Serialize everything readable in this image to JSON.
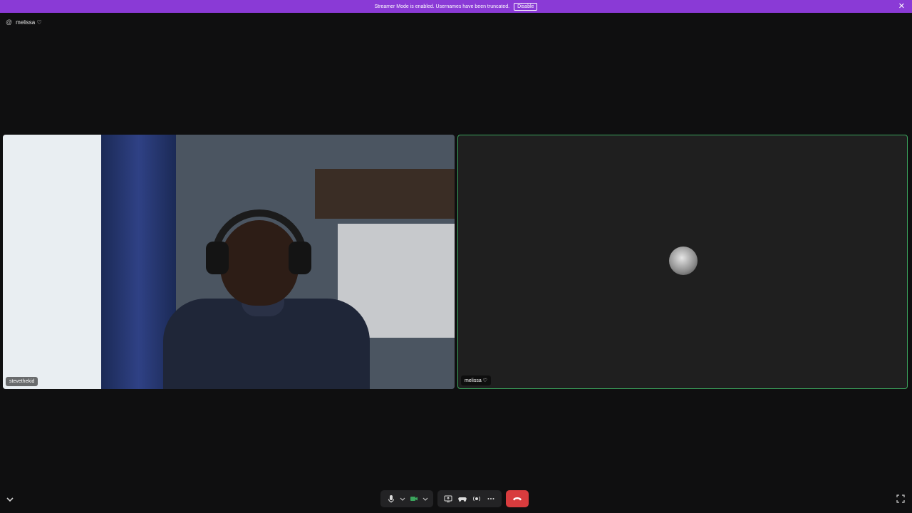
{
  "banner": {
    "message": "Streamer Mode is enabled. Usernames have been truncated.",
    "disable_label": "Disable"
  },
  "topbar": {
    "channel_name": "melissa ♡"
  },
  "tiles": {
    "left_name": "stevethekid",
    "right_name": "melissa ♡"
  },
  "colors": {
    "banner": "#8a3ad6",
    "active_border": "#3ba55d",
    "end_call": "#d83c3e",
    "video_btn": "#3ba55d"
  },
  "icons": {
    "mic": "microphone-icon",
    "camera": "video-camera-icon",
    "screen": "screen-share-icon",
    "activity": "game-controller-icon",
    "soundboard": "soundboard-icon",
    "more": "more-icon",
    "end": "end-call-icon"
  }
}
